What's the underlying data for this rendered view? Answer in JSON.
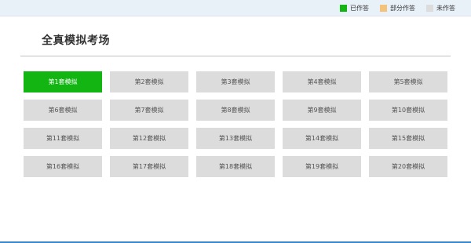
{
  "legend": {
    "items": [
      {
        "label": "已作答",
        "color": "#13b513"
      },
      {
        "label": "部分作答",
        "color": "#f5c27a"
      },
      {
        "label": "未作答",
        "color": "#dcdcdc"
      }
    ]
  },
  "page": {
    "title": "全真模拟考场"
  },
  "exams": [
    {
      "label": "第1套模拟",
      "status": "done"
    },
    {
      "label": "第2套模拟",
      "status": "none"
    },
    {
      "label": "第3套模拟",
      "status": "none"
    },
    {
      "label": "第4套模拟",
      "status": "none"
    },
    {
      "label": "第5套模拟",
      "status": "none"
    },
    {
      "label": "第6套模拟",
      "status": "none"
    },
    {
      "label": "第7套模拟",
      "status": "none"
    },
    {
      "label": "第8套模拟",
      "status": "none"
    },
    {
      "label": "第9套模拟",
      "status": "none"
    },
    {
      "label": "第10套模拟",
      "status": "none"
    },
    {
      "label": "第11套模拟",
      "status": "none"
    },
    {
      "label": "第12套模拟",
      "status": "none"
    },
    {
      "label": "第13套模拟",
      "status": "none"
    },
    {
      "label": "第14套模拟",
      "status": "none"
    },
    {
      "label": "第15套模拟",
      "status": "none"
    },
    {
      "label": "第16套模拟",
      "status": "none"
    },
    {
      "label": "第17套模拟",
      "status": "none"
    },
    {
      "label": "第18套模拟",
      "status": "none"
    },
    {
      "label": "第19套模拟",
      "status": "none"
    },
    {
      "label": "第20套模拟",
      "status": "none"
    }
  ]
}
